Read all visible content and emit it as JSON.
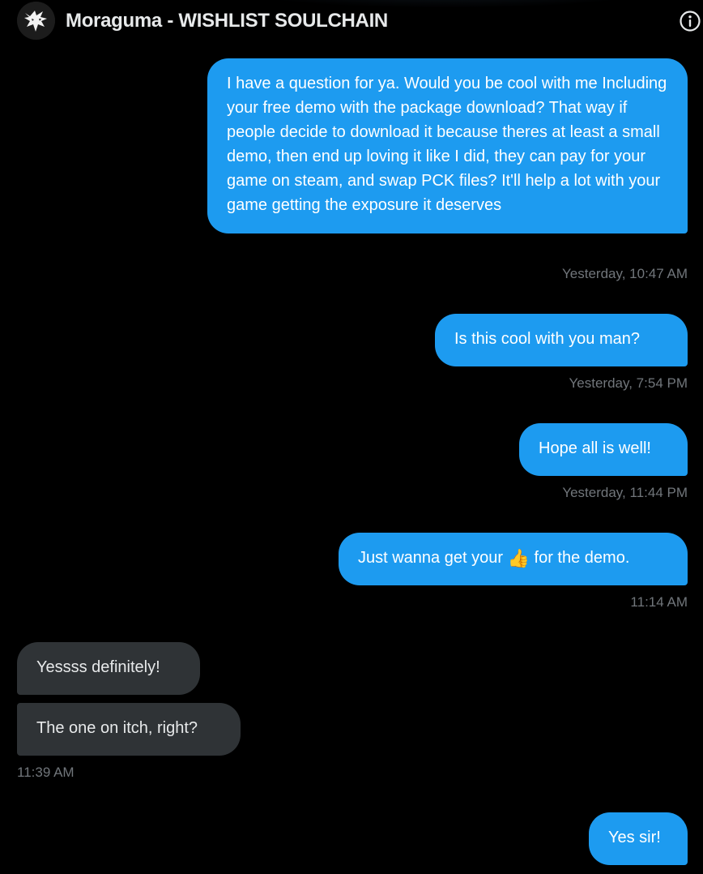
{
  "header": {
    "title": "Moraguma - WISHLIST SOULCHAIN",
    "avatar_icon": "wolf-logo",
    "info_icon": "info-icon"
  },
  "messages": [
    {
      "direction": "sent",
      "text": "I have a question for ya. Would you be cool with me Including your free demo with the package download? That way if people decide to download it because theres at least a small demo, then end up loving it like I did, they can pay for your game on steam, and swap PCK files? It'll help a lot with your game getting the exposure it deserves",
      "timestamp": "Yesterday, 10:47 AM"
    },
    {
      "direction": "sent",
      "text": "Is this cool with you man?",
      "timestamp": "Yesterday, 7:54 PM"
    },
    {
      "direction": "sent",
      "text": "Hope all is well!",
      "timestamp": "Yesterday, 11:44 PM"
    },
    {
      "direction": "sent",
      "text_before": "Just wanna get your",
      "emoji": "👍",
      "text_after": "for the demo.",
      "timestamp": "11:14 AM"
    },
    {
      "direction": "received",
      "text": "Yessss definitely!"
    },
    {
      "direction": "received",
      "text": "The one on itch, right?",
      "timestamp": "11:39 AM"
    },
    {
      "direction": "sent",
      "text": "Yes sir!"
    }
  ],
  "colors": {
    "background": "#000000",
    "sent_bubble": "#1d9bf0",
    "received_bubble": "#2f3336",
    "timestamp": "#71767b",
    "text": "#e7e9ea"
  }
}
